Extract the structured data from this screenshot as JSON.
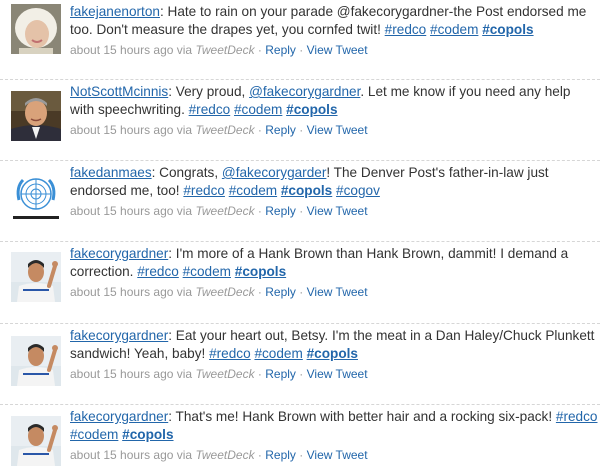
{
  "colors": {
    "link": "#2266aa",
    "meta": "#999999",
    "text": "#333333",
    "divider": "#d6d6d6"
  },
  "tweets": [
    {
      "user": "fakejanenorton",
      "avatar_icon": "portrait-blonde-woman",
      "parts": [
        {
          "t": "text",
          "v": ": Hate to rain on your parade @fakecorygardner-the Post endorsed me too. Don't measure the drapes yet, you cornfed twit! "
        },
        {
          "t": "tag",
          "v": "#redco"
        },
        {
          "t": "text",
          "v": " "
        },
        {
          "t": "tag",
          "v": "#codem"
        },
        {
          "t": "text",
          "v": " "
        },
        {
          "t": "tagb",
          "v": "#copols"
        }
      ],
      "time": "about 15 hours ago",
      "via": "via",
      "client": "TweetDeck",
      "reply": "Reply",
      "view": "View Tweet"
    },
    {
      "user": "NotScottMcinnis",
      "avatar_icon": "portrait-man-suit",
      "parts": [
        {
          "t": "text",
          "v": ": Very proud, "
        },
        {
          "t": "mention",
          "v": "@fakecorygardner"
        },
        {
          "t": "text",
          "v": ". Let me know if you need any help with speechwriting. "
        },
        {
          "t": "tag",
          "v": "#redco"
        },
        {
          "t": "text",
          "v": " "
        },
        {
          "t": "tag",
          "v": "#codem"
        },
        {
          "t": "text",
          "v": " "
        },
        {
          "t": "tagb",
          "v": "#copols"
        }
      ],
      "time": "about 15 hours ago",
      "via": "via",
      "client": "TweetDeck",
      "reply": "Reply",
      "view": "View Tweet"
    },
    {
      "user": "fakedanmaes",
      "avatar_icon": "un-emblem",
      "parts": [
        {
          "t": "text",
          "v": ": Congrats, "
        },
        {
          "t": "mention",
          "v": "@fakecorygarder"
        },
        {
          "t": "text",
          "v": "! The Denver Post's father-in-law just endorsed me, too! "
        },
        {
          "t": "tag",
          "v": "#redco"
        },
        {
          "t": "text",
          "v": " "
        },
        {
          "t": "tag",
          "v": "#codem"
        },
        {
          "t": "text",
          "v": " "
        },
        {
          "t": "tagb",
          "v": "#copols"
        },
        {
          "t": "text",
          "v": " "
        },
        {
          "t": "tag",
          "v": "#cogov"
        }
      ],
      "time": "about 15 hours ago",
      "via": "via",
      "client": "TweetDeck",
      "reply": "Reply",
      "view": "View Tweet"
    },
    {
      "user": "fakecorygardner",
      "avatar_icon": "portrait-man-waving",
      "parts": [
        {
          "t": "text",
          "v": ": I'm more of a Hank Brown than Hank Brown, dammit! I demand a correction. "
        },
        {
          "t": "tag",
          "v": "#redco"
        },
        {
          "t": "text",
          "v": " "
        },
        {
          "t": "tag",
          "v": "#codem"
        },
        {
          "t": "text",
          "v": " "
        },
        {
          "t": "tagb",
          "v": "#copols"
        }
      ],
      "time": "about 15 hours ago",
      "via": "via",
      "client": "TweetDeck",
      "reply": "Reply",
      "view": "View Tweet"
    },
    {
      "user": "fakecorygardner",
      "avatar_icon": "portrait-man-waving",
      "parts": [
        {
          "t": "text",
          "v": ": Eat your heart out, Betsy. I'm the meat in a Dan Haley/Chuck Plunkett sandwich! Yeah, baby! "
        },
        {
          "t": "tag",
          "v": "#redco"
        },
        {
          "t": "text",
          "v": " "
        },
        {
          "t": "tag",
          "v": "#codem"
        },
        {
          "t": "text",
          "v": " "
        },
        {
          "t": "tagb",
          "v": "#copols"
        }
      ],
      "time": "about 15 hours ago",
      "via": "via",
      "client": "TweetDeck",
      "reply": "Reply",
      "view": "View Tweet"
    },
    {
      "user": "fakecorygardner",
      "avatar_icon": "portrait-man-waving",
      "parts": [
        {
          "t": "text",
          "v": ": That's me! Hank Brown with better hair and a rocking six-pack! "
        },
        {
          "t": "tag",
          "v": "#redco"
        },
        {
          "t": "text",
          "v": " "
        },
        {
          "t": "tag",
          "v": "#codem"
        },
        {
          "t": "text",
          "v": " "
        },
        {
          "t": "tagb",
          "v": "#copols"
        }
      ],
      "time": "about 15 hours ago",
      "via": "via",
      "client": "TweetDeck",
      "reply": "Reply",
      "view": "View Tweet"
    }
  ]
}
